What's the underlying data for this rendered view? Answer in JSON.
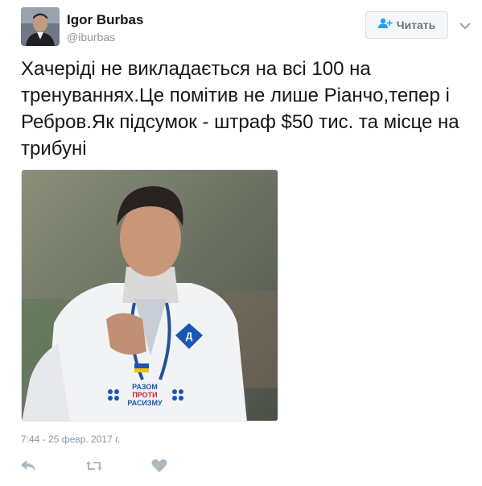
{
  "user": {
    "display_name": "Igor Burbas",
    "handle": "@iburbas"
  },
  "follow_button": {
    "label": "Читать",
    "icon": "add-user-icon"
  },
  "menu": {
    "icon": "chevron-down-icon"
  },
  "tweet": {
    "text": "Хачеріді не викладається на всі 100 на тренуваннях.Це помітив не лише Ріанчо,тепер і Ребров.Як підсумок - штраф $50 тис. та місце на трибуні",
    "media": {
      "description_icons": [
        "player-photo"
      ],
      "jersey_text": [
        "РАЗОМ",
        "ПРОТИ",
        "РАСИЗМУ"
      ],
      "crest_letter": "Д"
    },
    "timestamp": "7:44 - 25 февр. 2017 г."
  },
  "actions": [
    {
      "icon": "reply-icon"
    },
    {
      "icon": "retweet-icon"
    },
    {
      "icon": "like-icon"
    }
  ],
  "colors": {
    "text": "#14171a",
    "secondary": "#8899a6",
    "button_text": "#66757f",
    "button_border": "#d7dee3",
    "action_icon": "#aab8c2"
  }
}
